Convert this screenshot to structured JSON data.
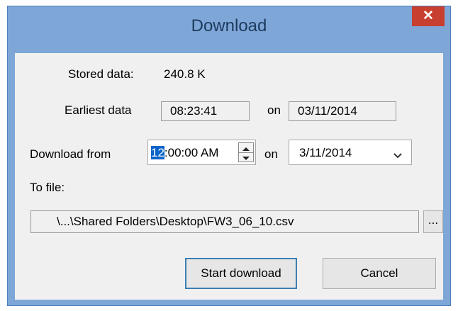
{
  "window": {
    "title": "Download",
    "close_glyph": "✕"
  },
  "stored": {
    "label": "Stored data:",
    "value": "240.8 K"
  },
  "earliest": {
    "label": "Earliest data",
    "time": "08:23:41",
    "on_label": "on",
    "date": "03/11/2014"
  },
  "download_from": {
    "label": "Download from",
    "time_selected": "12",
    "time_rest": ":00:00 AM",
    "on_label": "on",
    "date": "3/11/2014"
  },
  "to_file": {
    "label": "To file:",
    "path": "\\...\\Shared Folders\\Desktop\\FW3_06_10.csv",
    "browse_label": "..."
  },
  "buttons": {
    "start": "Start download",
    "cancel": "Cancel"
  },
  "colors": {
    "frame": "#7ea7d8",
    "close": "#c7402f",
    "selection": "#0a64c8"
  }
}
